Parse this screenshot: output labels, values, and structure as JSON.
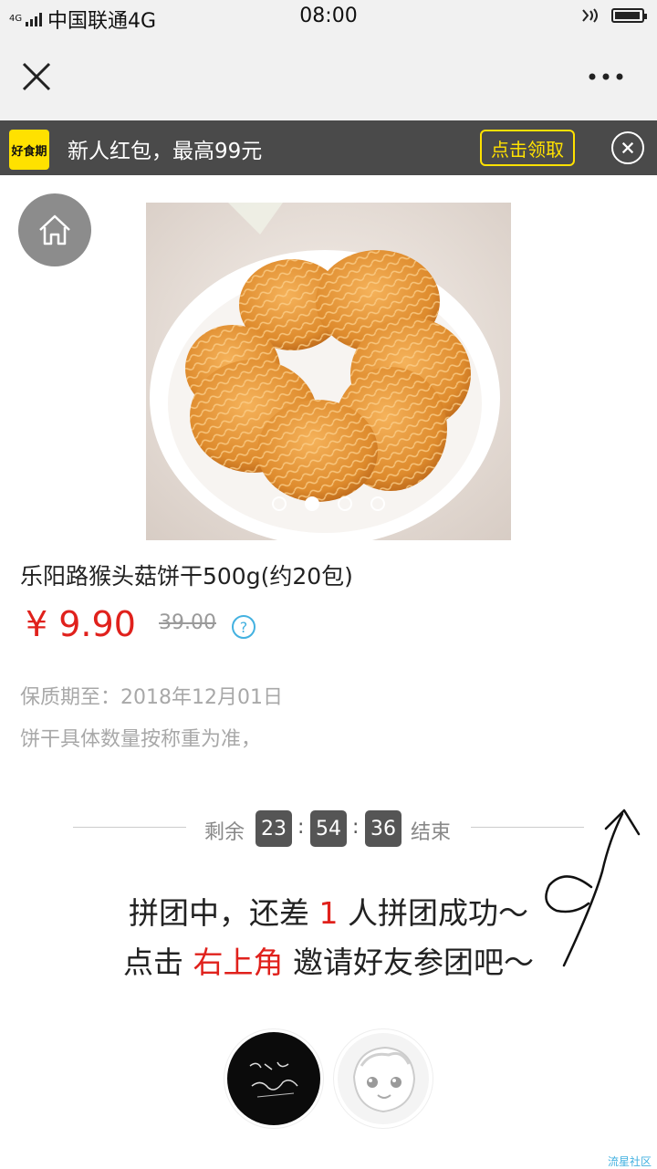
{
  "status_bar": {
    "network_small": "4G",
    "carrier": "中国联通4G",
    "time": "08:00",
    "battery_level": 0.95
  },
  "nav": {
    "close_icon": "close-icon",
    "more_icon": "more-dots-icon"
  },
  "promo": {
    "logo_text": "好食期",
    "text": "新人红包，最高99元",
    "button_label": "点击领取",
    "close_icon": "close-circle-icon"
  },
  "product": {
    "home_icon": "home-icon",
    "carousel": {
      "slide_count": 4,
      "active_index": 1
    },
    "title": "乐阳路猴头菇饼干500g(约20包)",
    "price": "¥ 9.90",
    "original_price": "39.00",
    "help_symbol": "?",
    "shelf_life": "保质期至：2018年12月01日",
    "note": "饼干具体数量按称重为准，"
  },
  "countdown": {
    "prefix": "剩余",
    "hours": "23",
    "minutes": "54",
    "seconds": "36",
    "separator": ":",
    "suffix": "结束"
  },
  "group": {
    "line1_a": "拼团中，还差 ",
    "line1_count": "1",
    "line1_b": " 人拼团成功～",
    "line2_a": "点击 ",
    "line2_highlight": "右上角",
    "line2_b": " 邀请好友参团吧～"
  },
  "watermark": "流星社区",
  "colors": {
    "accent_red": "#e0211c",
    "promo_yellow": "#ffe100",
    "banner_bg": "#4a4a4a",
    "help_blue": "#43b1e0"
  }
}
